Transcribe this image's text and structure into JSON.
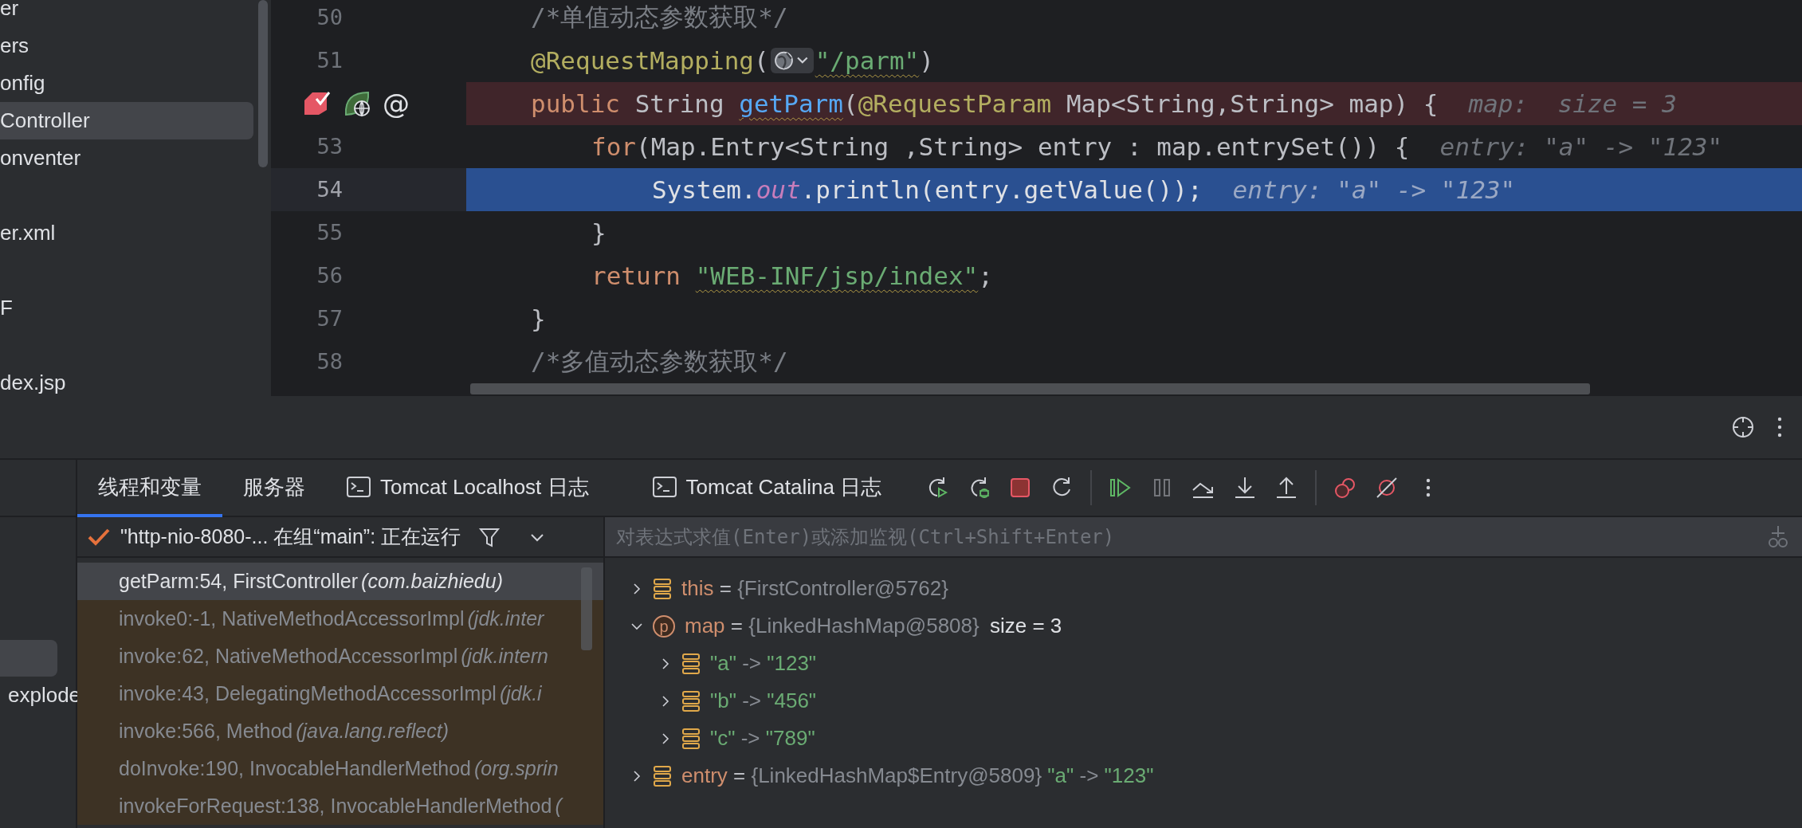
{
  "project_tree": {
    "items": [
      {
        "label": "er",
        "selected": false
      },
      {
        "label": "ers",
        "selected": false
      },
      {
        "label": "onfig",
        "selected": false
      },
      {
        "label": "Controller",
        "selected": true
      },
      {
        "label": "onventer",
        "selected": false
      },
      {
        "selected": false
      },
      {
        "label": "er.xml",
        "selected": false
      },
      {
        "selected": false
      },
      {
        "label": "F",
        "selected": false
      },
      {
        "selected": false
      },
      {
        "label": "dex.jsp",
        "selected": false
      }
    ]
  },
  "editor": {
    "lines": [
      {
        "number": "50",
        "kind": "member",
        "current": false,
        "breakpoint": false,
        "tokens": [
          {
            "kind": "comment",
            "text": "/*单值动态参数获取*/"
          }
        ]
      },
      {
        "number": "51",
        "kind": "member",
        "current": false,
        "breakpoint": false,
        "tokens": [
          {
            "kind": "annotation",
            "text": "@RequestMapping"
          },
          {
            "kind": "plain",
            "text": "("
          },
          {
            "kind": "chip"
          },
          {
            "kind": "string",
            "text": "\"/parm\"",
            "warning": true
          },
          {
            "kind": "plain",
            "text": ")"
          }
        ]
      },
      {
        "kind": "member",
        "current": false,
        "breakpoint": true,
        "gutter_symbol": "@",
        "tokens": [
          {
            "kind": "keyword",
            "text": "public"
          },
          {
            "kind": "plain",
            "text": " String "
          },
          {
            "kind": "method",
            "text": "getParm",
            "warning": true
          },
          {
            "kind": "plain",
            "text": "("
          },
          {
            "kind": "annotation",
            "text": "@RequestParam"
          },
          {
            "kind": "plain",
            "text": " Map<String,String> map) {"
          },
          {
            "kind": "hint",
            "text": "map:  size = 3"
          }
        ]
      },
      {
        "number": "53",
        "kind": "statement",
        "current": false,
        "breakpoint": false,
        "tokens": [
          {
            "kind": "keyword",
            "text": "for"
          },
          {
            "kind": "plain",
            "text": "(Map.Entry<String ,String> entry : map.entrySet()) {"
          },
          {
            "kind": "hint",
            "text": "entry: \"a\" -> \"123\""
          }
        ]
      },
      {
        "number": "54",
        "kind": "nested",
        "current": true,
        "breakpoint": false,
        "tokens": [
          {
            "kind": "plain",
            "text": "System."
          },
          {
            "kind": "field",
            "text": "out"
          },
          {
            "kind": "plain",
            "text": ".println(entry.getValue());"
          },
          {
            "kind": "hint",
            "text": "entry: \"a\" -> \"123\""
          }
        ]
      },
      {
        "number": "55",
        "kind": "statement",
        "current": false,
        "breakpoint": false,
        "tokens": [
          {
            "kind": "plain",
            "text": "}"
          }
        ]
      },
      {
        "number": "56",
        "kind": "statement",
        "current": false,
        "breakpoint": false,
        "tokens": [
          {
            "kind": "keyword",
            "text": "return "
          },
          {
            "kind": "string",
            "text": "\"WEB-INF/jsp/index\"",
            "warning": true
          },
          {
            "kind": "plain",
            "text": ";"
          }
        ]
      },
      {
        "number": "57",
        "kind": "member",
        "current": false,
        "breakpoint": false,
        "tokens": [
          {
            "kind": "plain",
            "text": "}"
          }
        ]
      },
      {
        "number": "58",
        "kind": "member",
        "current": false,
        "breakpoint": false,
        "tokens": [
          {
            "kind": "comment",
            "text": "/*多值动态参数获取*/"
          }
        ]
      }
    ]
  },
  "services_tree": [
    {
      "selected": true
    },
    {
      "label": "explode",
      "selected": false
    }
  ],
  "debug_tabs": [
    {
      "label": "线程和变量",
      "kind": "plain",
      "selected": true
    },
    {
      "label": "服务器",
      "kind": "plain",
      "selected": false
    },
    {
      "label": "Tomcat Localhost 日志",
      "kind": "console",
      "selected": false
    },
    {
      "label": "Tomcat Catalina 日志",
      "kind": "console",
      "selected": false
    }
  ],
  "toolbar": [
    {
      "kind": "rerun",
      "disabled": false
    },
    {
      "kind": "rerun-debug",
      "disabled": false
    },
    {
      "kind": "stop",
      "disabled": false
    },
    {
      "kind": "restart",
      "disabled": false
    },
    {
      "kind": "separator"
    },
    {
      "kind": "resume",
      "disabled": false
    },
    {
      "kind": "pause",
      "disabled": true
    },
    {
      "kind": "step-over",
      "disabled": false
    },
    {
      "kind": "step-into",
      "disabled": false
    },
    {
      "kind": "step-out",
      "disabled": false
    },
    {
      "kind": "separator"
    },
    {
      "kind": "breakpoints",
      "disabled": false
    },
    {
      "kind": "mute-breakpoints",
      "disabled": false
    },
    {
      "kind": "more",
      "disabled": false
    }
  ],
  "thread_selector": {
    "text": "\"http-nio-8080-... 在组“main”: 正在运行"
  },
  "frames": [
    {
      "location": "getParm:54, FirstController",
      "package": "(com.baizhiedu)",
      "library": false,
      "selected": true
    },
    {
      "location": "invoke0:-1, NativeMethodAccessorImpl",
      "package": "(jdk.inter",
      "library": true,
      "selected": false
    },
    {
      "location": "invoke:62, NativeMethodAccessorImpl",
      "package": "(jdk.intern",
      "library": true,
      "selected": false
    },
    {
      "location": "invoke:43, DelegatingMethodAccessorImpl",
      "package": "(jdk.i",
      "library": true,
      "selected": false
    },
    {
      "location": "invoke:566, Method",
      "package": "(java.lang.reflect)",
      "library": true,
      "selected": false
    },
    {
      "location": "doInvoke:190, InvocableHandlerMethod",
      "package": "(org.sprin",
      "library": true,
      "selected": false
    },
    {
      "location": "invokeForRequest:138, InvocableHandlerMethod",
      "package": "(",
      "library": true,
      "selected": false
    }
  ],
  "expression_field": {
    "placeholder": "对表达式求值(Enter)或添加监视(Ctrl+Shift+Enter)"
  },
  "variables": [
    {
      "kind": "field",
      "expanded": false,
      "parts": [
        {
          "kind": "name",
          "text": "this"
        },
        {
          "kind": "operator",
          "text": "="
        },
        {
          "kind": "object",
          "text": "{FirstController@5762}"
        }
      ]
    },
    {
      "kind": "parameter",
      "badge": "p",
      "expanded": true,
      "parts": [
        {
          "kind": "name",
          "text": "map"
        },
        {
          "kind": "operator",
          "text": "="
        },
        {
          "kind": "object",
          "text": "{LinkedHashMap@5808}"
        },
        {
          "kind": "extra",
          "text": "size = 3"
        }
      ],
      "children": [
        {
          "kind": "field",
          "expanded": false,
          "parts": [
            {
              "kind": "string",
              "text": "\"a\""
            },
            {
              "kind": "arrow",
              "text": "->"
            },
            {
              "kind": "string",
              "text": "\"123\""
            }
          ]
        },
        {
          "kind": "field",
          "expanded": false,
          "parts": [
            {
              "kind": "string",
              "text": "\"b\""
            },
            {
              "kind": "arrow",
              "text": "->"
            },
            {
              "kind": "string",
              "text": "\"456\""
            }
          ]
        },
        {
          "kind": "field",
          "expanded": false,
          "parts": [
            {
              "kind": "string",
              "text": "\"c\""
            },
            {
              "kind": "arrow",
              "text": "->"
            },
            {
              "kind": "string",
              "text": "\"789\""
            }
          ]
        }
      ]
    },
    {
      "kind": "field",
      "expanded": false,
      "parts": [
        {
          "kind": "name",
          "text": "entry"
        },
        {
          "kind": "operator",
          "text": "="
        },
        {
          "kind": "object",
          "text": "{LinkedHashMap$Entry@5809}"
        },
        {
          "kind": "string",
          "text": "\"a\""
        },
        {
          "kind": "arrow",
          "text": "->"
        },
        {
          "kind": "string",
          "text": "\"123\""
        }
      ]
    }
  ]
}
